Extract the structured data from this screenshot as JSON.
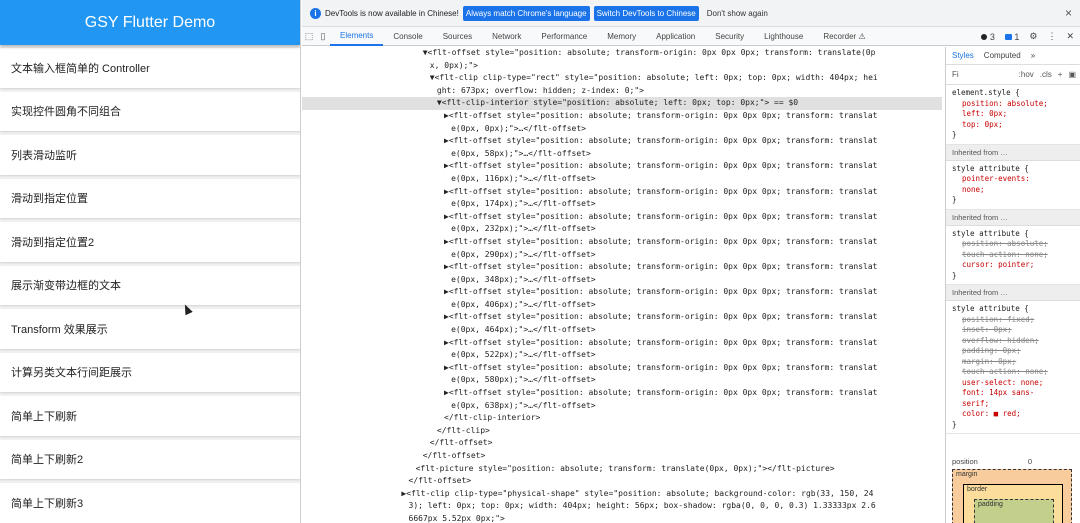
{
  "app": {
    "title": "GSY Flutter Demo",
    "items": [
      "文本输入框简单的 Controller",
      "实现控件圆角不同组合",
      "列表滑动监听",
      "滑动到指定位置",
      "滑动到指定位置2",
      "展示渐变带边框的文本",
      "Transform 效果展示",
      "计算另类文本行间距展示",
      "简单上下刷新",
      "简单上下刷新2",
      "简单上下刷新3"
    ]
  },
  "infobar": {
    "message": "DevTools is now available in Chinese!",
    "btn_match": "Always match Chrome's language",
    "btn_switch": "Switch DevTools to Chinese",
    "link_dont_show": "Don't show again",
    "close": "×"
  },
  "tabs": [
    "Elements",
    "Console",
    "Sources",
    "Network",
    "Performance",
    "Memory",
    "Application",
    "Security",
    "Lighthouse",
    "Recorder ⚠"
  ],
  "tab_right": {
    "errors": "3",
    "issues": "1"
  },
  "dom_lines": [
    {
      "indent": 17,
      "text": "▼<flt-offset style=\"position: absolute; transform-origin: 0px 0px 0px; transform: translate(0p",
      "hl": false
    },
    {
      "indent": 18,
      "text": "x, 0px);\">",
      "hl": false
    },
    {
      "indent": 18,
      "text": "▼<flt-clip clip-type=\"rect\" style=\"position: absolute; left: 0px; top: 0px; width: 404px; hei",
      "hl": false
    },
    {
      "indent": 19,
      "text": "ght: 673px; overflow: hidden; z-index: 0;\">",
      "hl": false
    },
    {
      "indent": 19,
      "text": "▼<flt-clip-interior style=\"position: absolute; left: 0px; top: 0px;\"> == $0",
      "hl": true
    },
    {
      "indent": 20,
      "text": "▶<flt-offset style=\"position: absolute; transform-origin: 0px 0px 0px; transform: translat",
      "hl": false
    },
    {
      "indent": 21,
      "text": "e(0px, 0px);\">…</flt-offset>",
      "hl": false
    },
    {
      "indent": 20,
      "text": "▶<flt-offset style=\"position: absolute; transform-origin: 0px 0px 0px; transform: translat",
      "hl": false
    },
    {
      "indent": 21,
      "text": "e(0px, 58px);\">…</flt-offset>",
      "hl": false
    },
    {
      "indent": 20,
      "text": "▶<flt-offset style=\"position: absolute; transform-origin: 0px 0px 0px; transform: translat",
      "hl": false
    },
    {
      "indent": 21,
      "text": "e(0px, 116px);\">…</flt-offset>",
      "hl": false
    },
    {
      "indent": 20,
      "text": "▶<flt-offset style=\"position: absolute; transform-origin: 0px 0px 0px; transform: translat",
      "hl": false
    },
    {
      "indent": 21,
      "text": "e(0px, 174px);\">…</flt-offset>",
      "hl": false
    },
    {
      "indent": 20,
      "text": "▶<flt-offset style=\"position: absolute; transform-origin: 0px 0px 0px; transform: translat",
      "hl": false
    },
    {
      "indent": 21,
      "text": "e(0px, 232px);\">…</flt-offset>",
      "hl": false
    },
    {
      "indent": 20,
      "text": "▶<flt-offset style=\"position: absolute; transform-origin: 0px 0px 0px; transform: translat",
      "hl": false
    },
    {
      "indent": 21,
      "text": "e(0px, 290px);\">…</flt-offset>",
      "hl": false
    },
    {
      "indent": 20,
      "text": "▶<flt-offset style=\"position: absolute; transform-origin: 0px 0px 0px; transform: translat",
      "hl": false
    },
    {
      "indent": 21,
      "text": "e(0px, 348px);\">…</flt-offset>",
      "hl": false
    },
    {
      "indent": 20,
      "text": "▶<flt-offset style=\"position: absolute; transform-origin: 0px 0px 0px; transform: translat",
      "hl": false
    },
    {
      "indent": 21,
      "text": "e(0px, 406px);\">…</flt-offset>",
      "hl": false
    },
    {
      "indent": 20,
      "text": "▶<flt-offset style=\"position: absolute; transform-origin: 0px 0px 0px; transform: translat",
      "hl": false
    },
    {
      "indent": 21,
      "text": "e(0px, 464px);\">…</flt-offset>",
      "hl": false
    },
    {
      "indent": 20,
      "text": "▶<flt-offset style=\"position: absolute; transform-origin: 0px 0px 0px; transform: translat",
      "hl": false
    },
    {
      "indent": 21,
      "text": "e(0px, 522px);\">…</flt-offset>",
      "hl": false
    },
    {
      "indent": 20,
      "text": "▶<flt-offset style=\"position: absolute; transform-origin: 0px 0px 0px; transform: translat",
      "hl": false
    },
    {
      "indent": 21,
      "text": "e(0px, 580px);\">…</flt-offset>",
      "hl": false
    },
    {
      "indent": 20,
      "text": "▶<flt-offset style=\"position: absolute; transform-origin: 0px 0px 0px; transform: translat",
      "hl": false
    },
    {
      "indent": 21,
      "text": "e(0px, 638px);\">…</flt-offset>",
      "hl": false
    },
    {
      "indent": 20,
      "text": "</flt-clip-interior>",
      "hl": false
    },
    {
      "indent": 19,
      "text": "</flt-clip>",
      "hl": false
    },
    {
      "indent": 18,
      "text": "</flt-offset>",
      "hl": false
    },
    {
      "indent": 17,
      "text": "</flt-offset>",
      "hl": false
    },
    {
      "indent": 16,
      "text": "<flt-picture style=\"position: absolute; transform: translate(0px, 0px);\"></flt-picture>",
      "hl": false
    },
    {
      "indent": 15,
      "text": "</flt-offset>",
      "hl": false
    },
    {
      "indent": 14,
      "text": "▶<flt-clip clip-type=\"physical-shape\" style=\"position: absolute; background-color: rgb(33, 150, 24",
      "hl": false
    },
    {
      "indent": 15,
      "text": "3); left: 0px; top: 0px; width: 404px; height: 56px; box-shadow: rgba(0, 0, 0, 0.3) 1.33333px 2.6",
      "hl": false
    },
    {
      "indent": 15,
      "text": "6667px 5.52px 0px;\">",
      "hl": false
    }
  ],
  "styles": {
    "tabs": [
      "Styles",
      "Computed",
      "»"
    ],
    "filter": "Fi",
    "hov": ":hov",
    "cls": ".cls",
    "plus": "+",
    "rules": [
      {
        "type": "rule",
        "selector": "element.style {",
        "props": [
          "position: absolute;",
          "left: 0px;",
          "top: 0px;"
        ],
        "struck": [],
        "close": "}"
      },
      {
        "type": "head",
        "text": "Inherited from …"
      },
      {
        "type": "rule",
        "selector": "style attribute {",
        "props": [
          "pointer-events:",
          "none;"
        ],
        "struck": [],
        "close": "}"
      },
      {
        "type": "head",
        "text": "Inherited from …"
      },
      {
        "type": "rule",
        "selector": "style attribute {",
        "props": [
          "cursor: pointer;"
        ],
        "struck": [
          "position: absolute;",
          "touch-action: none;"
        ],
        "close": "}"
      },
      {
        "type": "head",
        "text": "Inherited from …"
      },
      {
        "type": "rule",
        "selector": "style attribute {",
        "props": [
          "user-select: none;",
          "font: 14px sans-",
          "serif;",
          "color: ■ red;"
        ],
        "struck": [
          "position: fixed;",
          "inset: 0px;",
          "overflow: hidden;",
          "padding: 0px;",
          "margin: 0px;",
          "touch-action: none;"
        ],
        "close": "}"
      }
    ],
    "box_model": {
      "title": "position",
      "title_value": "0",
      "margin": "margin",
      "margin_value": "-",
      "border": "border",
      "padding": "padding"
    }
  }
}
